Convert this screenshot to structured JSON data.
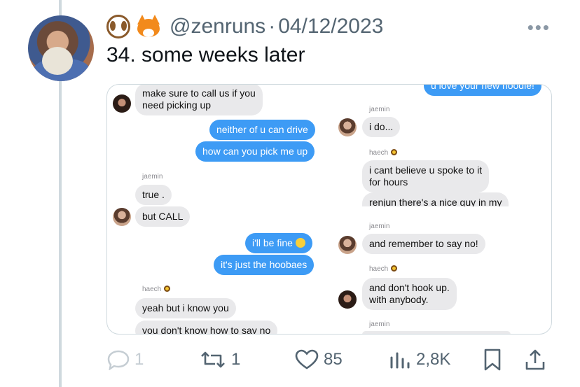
{
  "tweet": {
    "handle": "@zenruns",
    "separator": "·",
    "date": "04/12/2023",
    "more_label": "•••",
    "text": "34. some weeks later"
  },
  "chat": {
    "left_column": [
      {
        "text": "make sure to call us if you\nneed picking up",
        "side": "left"
      },
      {
        "text": "neither of u can drive",
        "side": "right"
      },
      {
        "text": "how can you pick me up",
        "side": "right"
      },
      {
        "sender": "jaemin"
      },
      {
        "text": "true .",
        "side": "left"
      },
      {
        "text": "but CALL",
        "side": "left"
      },
      {
        "text": "i'll be fine",
        "side": "right"
      },
      {
        "text": "it's just the hoobaes",
        "side": "right"
      },
      {
        "sender": "haech"
      },
      {
        "text": "yeah but i know you",
        "side": "left"
      },
      {
        "text": "you don't know how to say no",
        "side": "left"
      }
    ],
    "right_column": [
      {
        "text": "u love your new hoodie!",
        "side": "right"
      },
      {
        "sender": "jaemin"
      },
      {
        "text": "i do...",
        "side": "left"
      },
      {
        "sender": "haech"
      },
      {
        "text": "i cant believe u spoke to it\nfor hours",
        "side": "left"
      },
      {
        "text": "renjun there's a nice guy in my",
        "side": "left"
      },
      {
        "sender": "jaemin"
      },
      {
        "text": "and remember to say no!",
        "side": "left"
      },
      {
        "sender": "haech"
      },
      {
        "text": "and don't hook up.\nwith anybody.",
        "side": "left"
      },
      {
        "sender": "jaemin"
      }
    ]
  },
  "actions": {
    "reply_count": "1",
    "retweet_count": "1",
    "like_count": "85",
    "views_count": "2,8K"
  },
  "colors": {
    "imessage_blue": "#3d9bf5",
    "imessage_gray": "#e9e9eb",
    "secondary_text": "#536471"
  }
}
